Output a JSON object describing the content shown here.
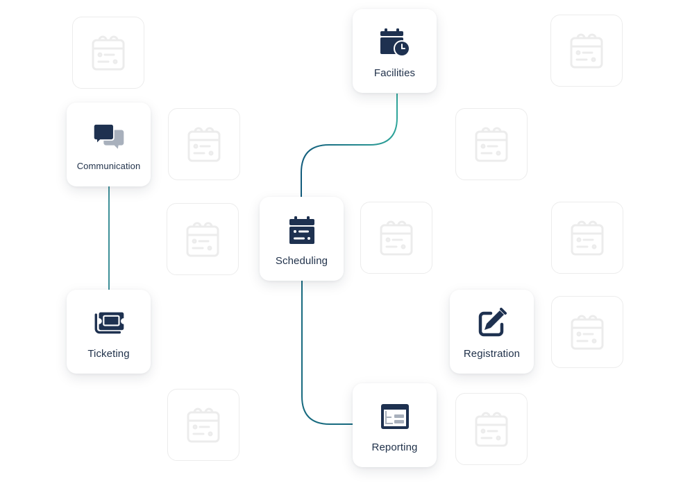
{
  "diagram": {
    "colors": {
      "icon_primary": "#1e3150",
      "icon_secondary": "#a8b0bc",
      "ghost_stroke": "#ececec",
      "line_start": "#125c7c",
      "line_end": "#2fa59a"
    },
    "nodes": [
      {
        "id": "facilities",
        "label": "Facilities",
        "icon": "calendar-clock-icon"
      },
      {
        "id": "communication",
        "label": "Communication",
        "icon": "chat-bubbles-icon"
      },
      {
        "id": "scheduling",
        "label": "Scheduling",
        "icon": "calendar-icon"
      },
      {
        "id": "ticketing",
        "label": "Ticketing",
        "icon": "ticket-icon"
      },
      {
        "id": "registration",
        "label": "Registration",
        "icon": "edit-icon"
      },
      {
        "id": "reporting",
        "label": "Reporting",
        "icon": "report-window-icon"
      }
    ],
    "edges": [
      {
        "from": "facilities",
        "to": "scheduling"
      },
      {
        "from": "communication",
        "to": "ticketing"
      },
      {
        "from": "ticketing",
        "to": "registration"
      },
      {
        "from": "scheduling",
        "to": "reporting"
      }
    ],
    "placeholder_icon": "calendar-outline-icon",
    "placeholder_count": 10
  }
}
